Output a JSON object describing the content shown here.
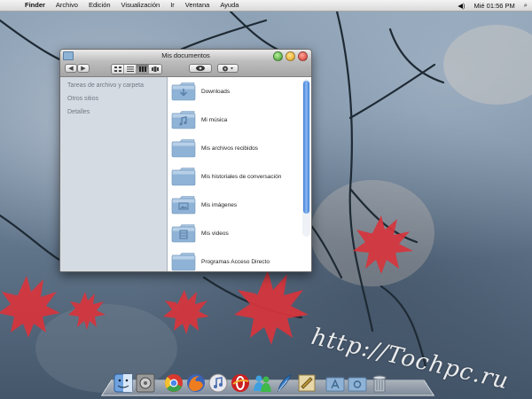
{
  "menubar": {
    "apple_glyph": "",
    "app_name": "Finder",
    "items": [
      "Archivo",
      "Edición",
      "Visualización",
      "Ir",
      "Ventana",
      "Ayuda"
    ],
    "volume_glyph": "◀)",
    "clock": "Mié 01:56 PM",
    "search_glyph": "⌕"
  },
  "window": {
    "title": "Mis documentos",
    "sidebar": [
      "Tareas de archivo y carpeta",
      "Otros sitios",
      "Detalles"
    ],
    "toolbar": {
      "back": "◀",
      "forward": "▶",
      "view_modes": [
        "icon",
        "list",
        "columns",
        "coverflow"
      ],
      "active_view": "columns"
    },
    "files": [
      {
        "name": "Downloads",
        "badge": "download"
      },
      {
        "name": "Mi música",
        "badge": "music"
      },
      {
        "name": "Mis archivos recibidos",
        "badge": "none"
      },
      {
        "name": "Mis historiales de conversación",
        "badge": "none"
      },
      {
        "name": "Mis imágenes",
        "badge": "picture"
      },
      {
        "name": "Mis videos",
        "badge": "film"
      },
      {
        "name": "Programas Acceso Directo",
        "badge": "none"
      }
    ]
  },
  "watermark": "http://Tochpc.ru",
  "colors": {
    "folder": "#8fb3d6",
    "scroll_thumb": "#3f7fd8",
    "leaf": "#d8343c"
  },
  "dock": [
    "finder-icon",
    "system-preferences-icon",
    "chrome-icon",
    "firefox-icon",
    "itunes-icon",
    "opera-icon",
    "messenger-icon",
    "feather-icon",
    "script-editor-icon",
    "applications-folder-icon",
    "documents-folder-icon",
    "trash-icon"
  ]
}
